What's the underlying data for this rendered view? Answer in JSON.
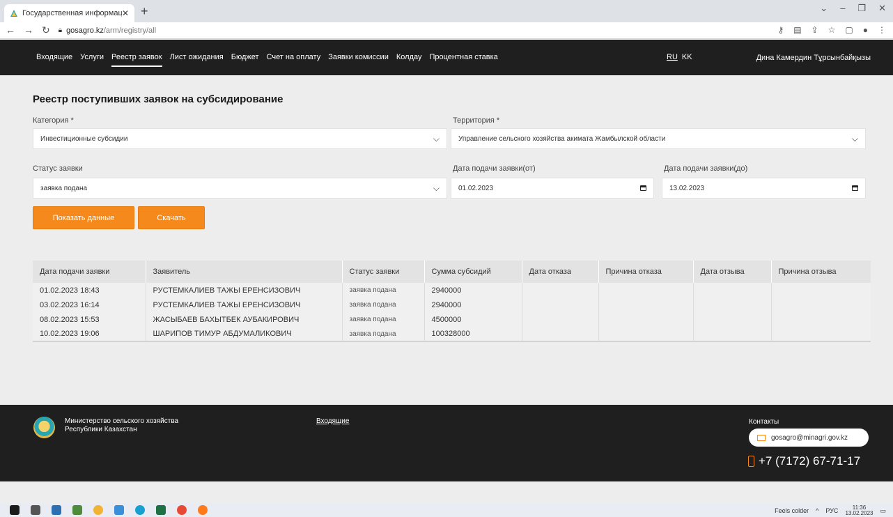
{
  "browser": {
    "tab_title": "Государственная информацион",
    "url_host": "gosagro.kz",
    "url_path": "/arm/registry/all"
  },
  "nav": {
    "items": [
      {
        "label": "Входящие",
        "active": false
      },
      {
        "label": "Услуги",
        "active": false
      },
      {
        "label": "Реестр заявок",
        "active": true
      },
      {
        "label": "Лист ожидания",
        "active": false
      },
      {
        "label": "Бюджет",
        "active": false
      },
      {
        "label": "Счет на оплату",
        "active": false
      },
      {
        "label": "Заявки комиссии",
        "active": false
      },
      {
        "label": "Колдау",
        "active": false
      },
      {
        "label": "Процентная ставка",
        "active": false
      }
    ],
    "lang_ru": "RU",
    "lang_kk": "KK",
    "user": "Дина Камердин Тұрсынбайқызы"
  },
  "page": {
    "title": "Реестр поступивших заявок на субсидирование"
  },
  "filters": {
    "category_label": "Категория *",
    "category_value": "Инвестиционные субсидии",
    "territory_label": "Территория *",
    "territory_value": "Управление сельского хозяйства акимата Жамбылской области",
    "status_label": "Статус заявки",
    "status_value": "заявка подана",
    "date_from_label": "Дата подачи заявки(от)",
    "date_from_value": "01.02.2023",
    "date_to_label": "Дата подачи заявки(до)",
    "date_to_value": "13.02.2023"
  },
  "buttons": {
    "show": "Показать данные",
    "download": "Скачать"
  },
  "table": {
    "headers": [
      "Дата подачи заявки",
      "Заявитель",
      "Статус заявки",
      "Сумма субсидий",
      "Дата отказа",
      "Причина отказа",
      "Дата отзыва",
      "Причина отзыва"
    ],
    "rows": [
      [
        "01.02.2023 18:43",
        "РУСТЕМКАЛИЕВ ТАЖЫ ЕРЕНСИЗОВИЧ",
        "заявка подана",
        "2940000",
        "",
        "",
        "",
        ""
      ],
      [
        "03.02.2023 16:14",
        "РУСТЕМКАЛИЕВ ТАЖЫ ЕРЕНСИЗОВИЧ",
        "заявка подана",
        "2940000",
        "",
        "",
        "",
        ""
      ],
      [
        "08.02.2023 15:53",
        "ЖАСЫБАЕВ БАХЫТБЕК АУБАКИРОВИЧ",
        "заявка подана",
        "4500000",
        "",
        "",
        "",
        ""
      ],
      [
        "10.02.2023 19:06",
        "ШАРИПОВ ТИМУР АБДУМАЛИКОВИЧ",
        "заявка подана",
        "100328000",
        "",
        "",
        "",
        ""
      ]
    ]
  },
  "footer": {
    "ministry_line1": "Министерство сельского хозяйства",
    "ministry_line2": "Республики Казахстан",
    "link": "Входящие",
    "contacts_title": "Контакты",
    "email": "gosagro@minagri.gov.kz",
    "phone": "+7 (7172) 67-71-17"
  },
  "taskbar": {
    "weather": "Feels colder",
    "lang": "РУС",
    "time": "11:36",
    "date": "13.02.2023"
  },
  "colors": {
    "accent": "#f5891b",
    "header_bg": "#1f1f1f"
  }
}
